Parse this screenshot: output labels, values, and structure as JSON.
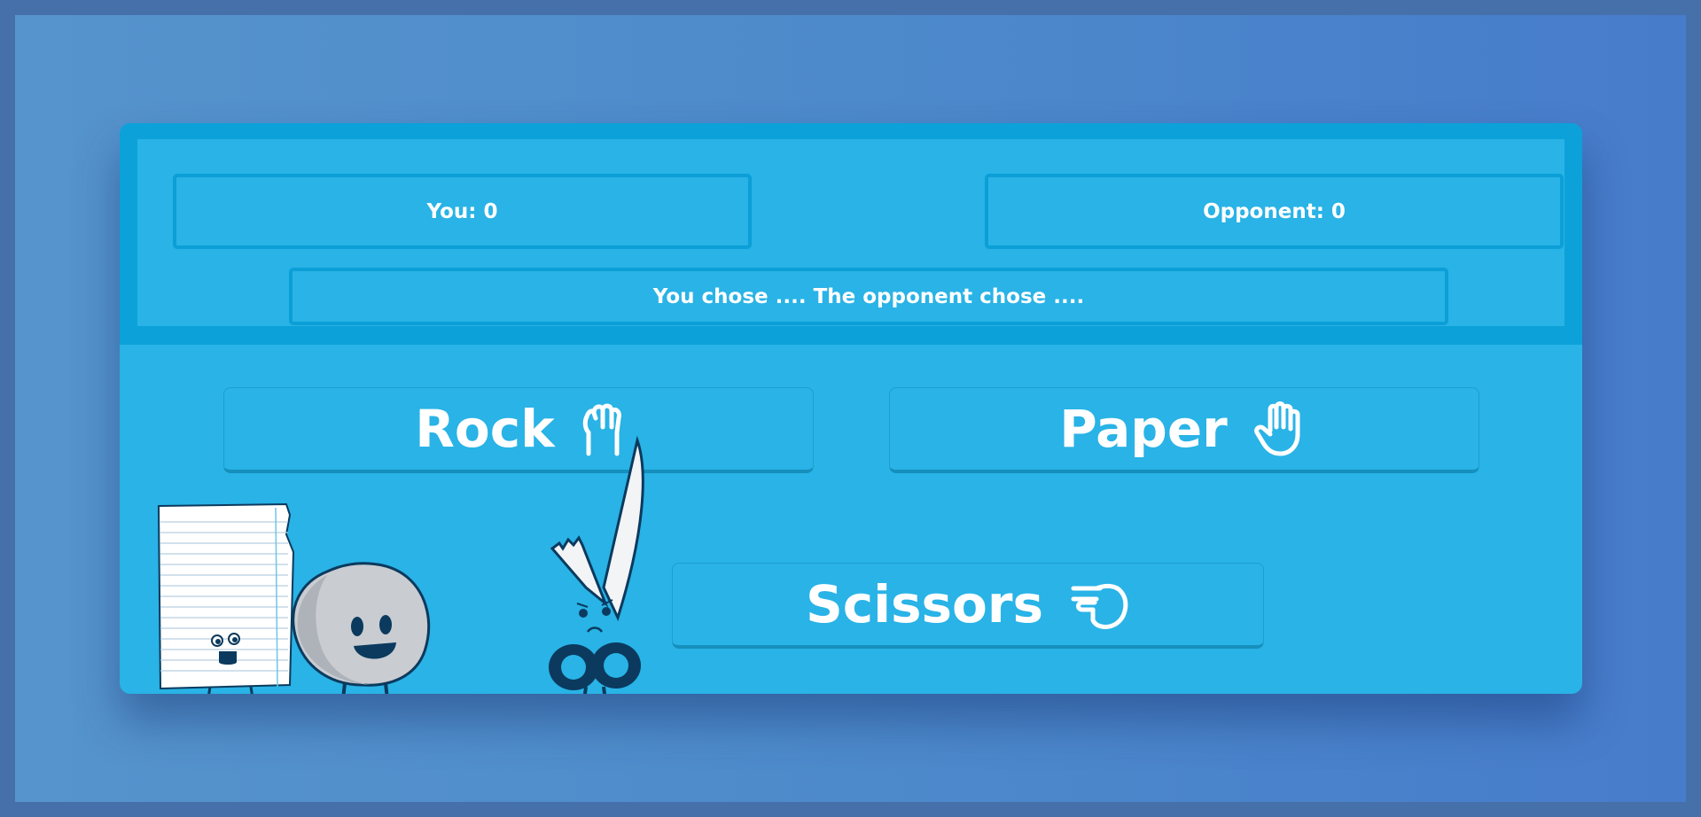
{
  "scoreboard": {
    "you_label": "You: 0",
    "opponent_label": "Opponent: 0",
    "result_text": "You chose .... The opponent chose ...."
  },
  "choices": {
    "rock": {
      "label": "Rock",
      "icon": "fist-icon"
    },
    "paper": {
      "label": "Paper",
      "icon": "open-hand-icon"
    },
    "scissors": {
      "label": "Scissors",
      "icon": "pointing-hand-icon"
    }
  },
  "colors": {
    "background": "#4670aa",
    "card": "#29b3e6",
    "scoreboard_frame": "#0ca1d9",
    "text": "#ffffff"
  },
  "illustration": {
    "characters": [
      "paper-character",
      "rock-character",
      "scissors-character"
    ]
  }
}
